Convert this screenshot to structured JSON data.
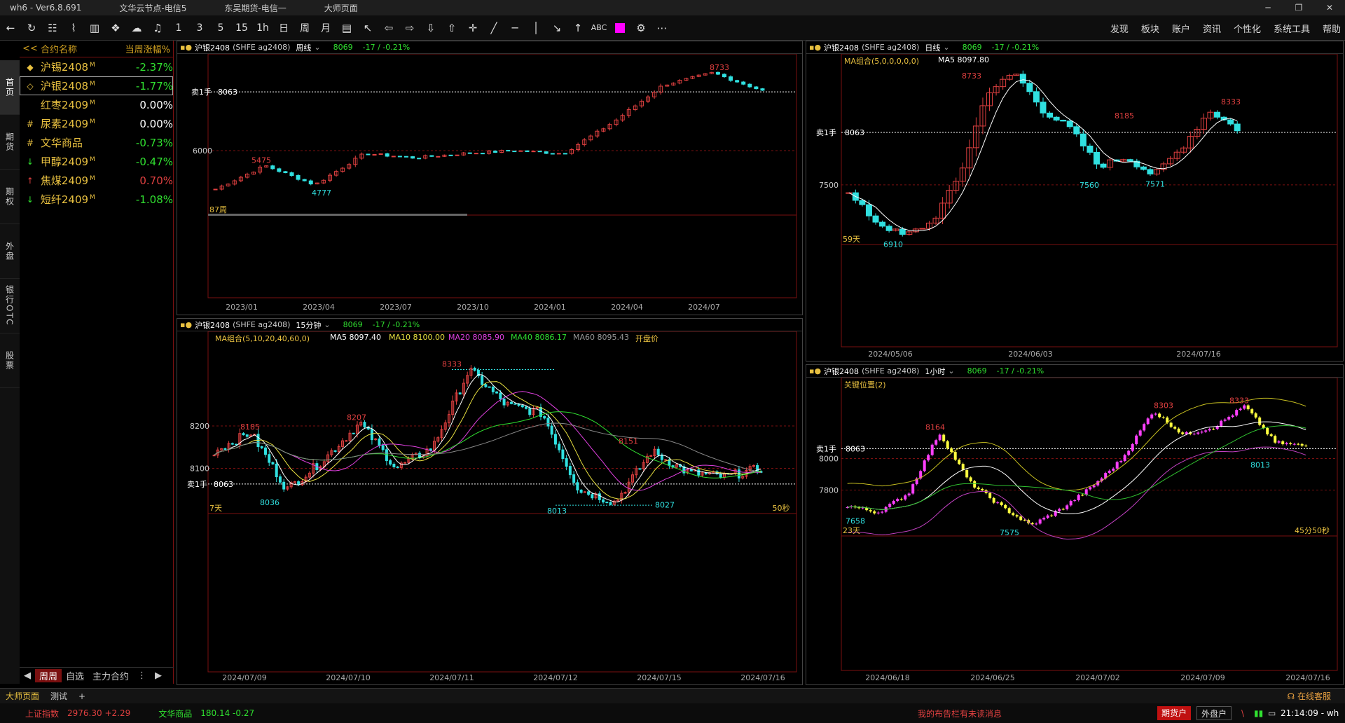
{
  "titlebar": {
    "app": "wh6 - Ver6.8.691",
    "node1": "文华云节点-电信5",
    "node2": "东吴期货-电信一",
    "page": "大师页面"
  },
  "toolbar": {
    "periods": [
      "1",
      "3",
      "5",
      "15",
      "1h",
      "日",
      "周",
      "月"
    ],
    "abc": "ABC",
    "right": [
      "发现",
      "板块",
      "账户",
      "资讯",
      "个性化",
      "系统工具",
      "帮助"
    ]
  },
  "sidetabs": [
    "首页",
    "期货",
    "期权",
    "外盘",
    "银行OTC",
    "股票"
  ],
  "watchlist": {
    "headers": {
      "arrow": "<<",
      "name": "合约名称",
      "change": "当周涨幅%"
    },
    "rows": [
      {
        "mark": "◆",
        "markColor": "#e8c040",
        "name": "沪锡2408",
        "sup": "M",
        "change": "-2.37%",
        "color": "#30e030"
      },
      {
        "mark": "◇",
        "markColor": "#e8c040",
        "name": "沪银2408",
        "sup": "M",
        "change": "-1.77%",
        "color": "#30e030",
        "selected": true
      },
      {
        "mark": "",
        "markColor": "#e8c040",
        "name": "红枣2409",
        "sup": "M",
        "change": "0.00%",
        "color": "#ffffff"
      },
      {
        "mark": "#",
        "markColor": "#e8c040",
        "name": "尿素2409",
        "sup": "M",
        "change": "0.00%",
        "color": "#ffffff"
      },
      {
        "mark": "#",
        "markColor": "#e8c040",
        "name": "文华商品",
        "sup": "",
        "change": "-0.73%",
        "color": "#30e030"
      },
      {
        "mark": "↓",
        "markColor": "#30e030",
        "name": "甲醇2409",
        "sup": "M",
        "change": "-0.47%",
        "color": "#30e030"
      },
      {
        "mark": "↑",
        "markColor": "#e04040",
        "name": "焦煤2409",
        "sup": "M",
        "change": "0.70%",
        "color": "#e04040"
      },
      {
        "mark": "↓",
        "markColor": "#30e030",
        "name": "短纤2409",
        "sup": "M",
        "change": "-1.08%",
        "color": "#30e030"
      }
    ],
    "footer": {
      "left": "◀",
      "tab1": "周周",
      "tab2": "自选",
      "tab3": "主力合约",
      "more": "⋮",
      "right": "▶"
    }
  },
  "panels": {
    "p1": {
      "symbol": "沪银2408",
      "sup": "M",
      "code": "(SHFE ag2408)",
      "period": "周线",
      "price": "8069",
      "change": "-17 / -0.21%",
      "labels": {
        "sell": "卖1手",
        "sellPrice": "8063",
        "y6000": "6000",
        "hi": "8733",
        "l5475": "5475",
        "l4777": "4777",
        "count": "87周"
      },
      "xaxis": [
        "2023/01",
        "2023/04",
        "2023/07",
        "2023/10",
        "2024/01",
        "2024/04",
        "2024/07"
      ]
    },
    "p2": {
      "symbol": "沪银2408",
      "sup": "M",
      "code": "(SHFE ag2408)",
      "period": "日线",
      "price": "8069",
      "change": "-17 / -0.21%",
      "ma": "MA组合(5,0,0,0,0,0)",
      "ma5": "MA5 8097.80",
      "labels": {
        "sell": "卖1手",
        "sellPrice": "8063",
        "y7500": "7500",
        "hi": "8733",
        "l8185": "8185",
        "l8333": "8333",
        "l7560": "7560",
        "l7571": "7571",
        "l6910": "6910",
        "count": "59天"
      },
      "xaxis": [
        "2024/05/06",
        "2024/06/03",
        "2024/07/16"
      ]
    },
    "p3": {
      "symbol": "沪银2408",
      "sup": "M",
      "code": "(SHFE ag2408)",
      "period": "15分钟",
      "price": "8069",
      "change": "-17 / -0.21%",
      "ma": {
        "title": "MA组合(5,10,20,40,60,0)",
        "ma5": "MA5 8097.40",
        "ma10": "MA10 8100.00",
        "ma20": "MA20 8085.90",
        "ma40": "MA40 8086.17",
        "ma60": "MA60 8095.43",
        "open": "开盘价"
      },
      "labels": {
        "sell": "卖1手",
        "sellPrice": "8063",
        "y8200": "8200",
        "y8100": "8100",
        "l8333": "8333",
        "l8185": "8185",
        "l8207": "8207",
        "l8151": "8151",
        "l8036": "8036",
        "l8013": "8013",
        "l8027": "8027",
        "count": "7天",
        "sec": "50秒"
      },
      "xaxis": [
        "2024/07/09",
        "2024/07/10",
        "2024/07/11",
        "2024/07/12",
        "2024/07/15",
        "2024/07/16"
      ]
    },
    "p4": {
      "symbol": "沪银2408",
      "sup": "M",
      "code": "(SHFE ag2408)",
      "period": "1小时",
      "price": "8069",
      "change": "-17 / -0.21%",
      "ind": "关键位置(2)",
      "labels": {
        "sell": "卖1手",
        "sellPrice": "8063",
        "y8000": "8000",
        "y7800": "7800",
        "l8164": "8164",
        "l8303": "8303",
        "l8333": "8333",
        "l8013": "8013",
        "l7658": "7658",
        "l7575": "7575",
        "count": "23天",
        "sec": "45分50秒"
      },
      "xaxis": [
        "2024/06/18",
        "2024/06/25",
        "2024/07/02",
        "2024/07/09",
        "2024/07/16"
      ]
    }
  },
  "status": {
    "tab1": "大师页面",
    "tab2": "测试",
    "add": "+",
    "service": "在线客服",
    "idx1": "上证指数",
    "idx1v": "2976.30  +2.29",
    "idx2": "文华商品",
    "idx2v": "180.14  -0.27",
    "msg": "我的布告栏有未读消息",
    "b1": "期货户",
    "b2": "外盘户",
    "time": "21:14:09 - wh"
  },
  "colors": {
    "up": "#e04040",
    "down": "#30e0e0",
    "accent": "#7a1010",
    "gold": "#e8c040"
  }
}
